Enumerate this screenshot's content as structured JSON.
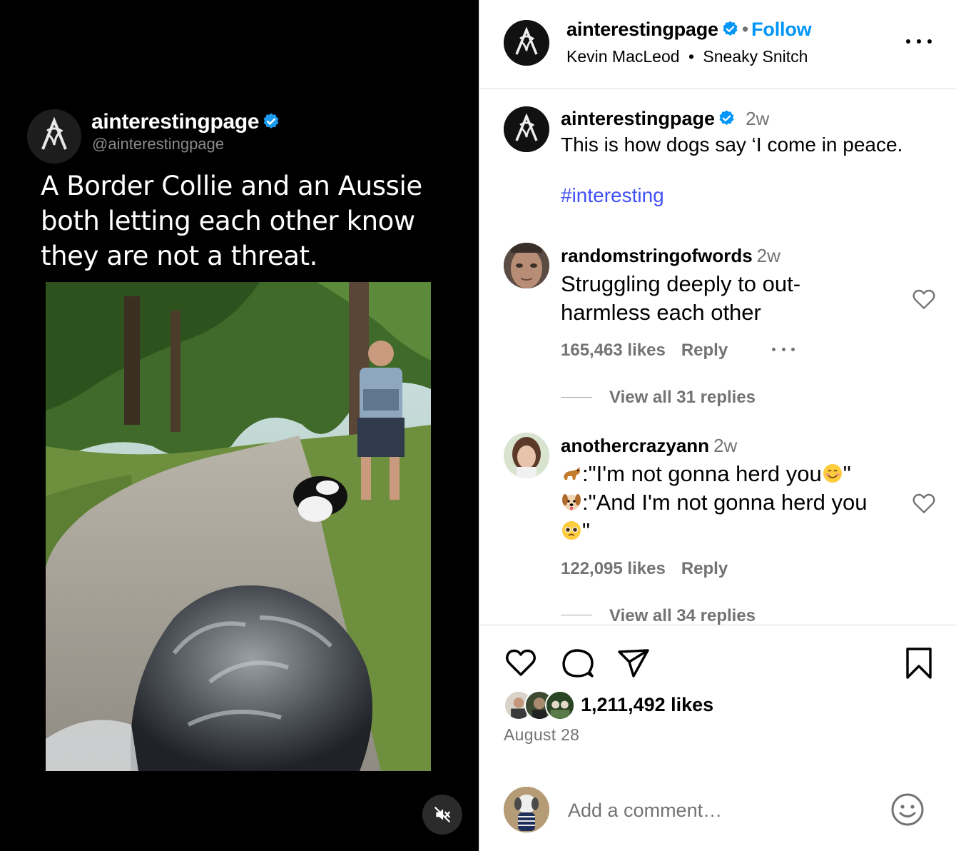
{
  "media": {
    "tweet_name": "ainterestingpage",
    "tweet_handle": "@ainterestingpage",
    "tweet_text": "A Border Collie and an Aussie both letting each other know they are not a threat."
  },
  "header": {
    "username": "ainterestingpage",
    "separator": "•",
    "follow_label": "Follow",
    "audio_artist": "Kevin MacLeod",
    "audio_separator": "•",
    "audio_track": "Sneaky Snitch"
  },
  "caption": {
    "username": "ainterestingpage",
    "age": "2w",
    "text": "This is how dogs say ‘I come in peace.",
    "hashtag": "#interesting"
  },
  "comments": [
    {
      "username": "randomstringofwords",
      "age": "2w",
      "line1": "Struggling deeply to out-",
      "line2": "harmless each other",
      "likes": "165,463 likes",
      "reply_label": "Reply",
      "view_replies": "View all 31 replies"
    },
    {
      "username": "anothercrazyann",
      "age": "2w",
      "line1": ":\"I'm not gonna herd you",
      "line1_end": "\"",
      "line2": ":\"And I'm not gonna herd you",
      "line3": "\"",
      "likes": "122,095 likes",
      "reply_label": "Reply",
      "view_replies": "View all 34 replies"
    }
  ],
  "actions": {
    "likes_count": "1,211,492 likes",
    "date": "August 28"
  },
  "add_comment": {
    "placeholder": "Add a comment…"
  },
  "colors": {
    "accent_blue": "#0095f6",
    "hashtag_blue": "#4150f7",
    "muted_gray": "#737373",
    "verified_blue": "#0095f6",
    "media_background": "#000000"
  },
  "icons": [
    "verified-badge-icon",
    "more-options-icon",
    "heart-icon",
    "comment-icon",
    "share-icon",
    "bookmark-icon",
    "mute-icon",
    "emoji-icon"
  ]
}
